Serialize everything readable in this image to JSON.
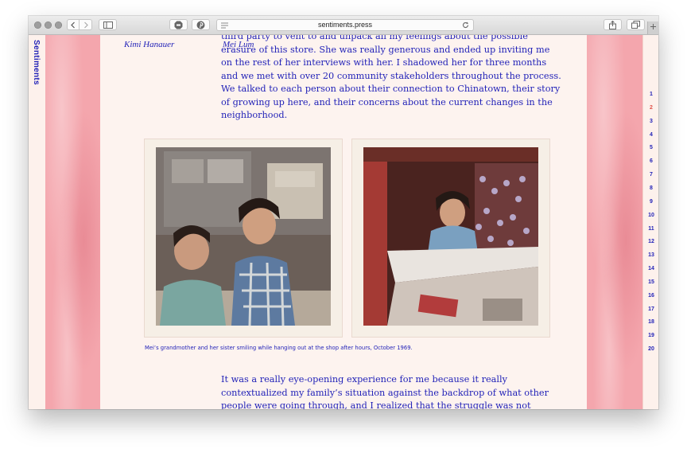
{
  "browser": {
    "url": "sentiments.press",
    "colors": {
      "toolbar": "#dcdcdc",
      "traffic_light": "#9e9e9e"
    }
  },
  "site": {
    "brand": "Sentiments",
    "accent_color": "#2323b8",
    "background_color": "#fdf3ef",
    "side_photo_tint": "#f4a6ad"
  },
  "article": {
    "author": "Kimi Hanauer",
    "subject": "Mei Lum",
    "paragraph_1": "third party to vent to and unpack all my feelings about the possible erasure of this store. She was really generous and ended up inviting me on the rest of her interviews with her. I shadowed her for three months and we met with over 20 community stakeholders throughout the process. We talked to each person about their connection to Chinatown, their story of growing up here, and their concerns about the current changes in the neighborhood.",
    "caption": "Mei’s grandmother and her sister smiling while hanging out at the shop after hours, October 1969.",
    "paragraph_2": "It was a really eye-opening experience for me because it really contextualized my family’s situation against the backdrop of what other people were going through, and I realized that the struggle was not isolated to my family. I also started to think"
  },
  "pages": [
    "1",
    "2",
    "3",
    "4",
    "5",
    "6",
    "7",
    "8",
    "9",
    "10",
    "11",
    "12",
    "13",
    "14",
    "15",
    "16",
    "17",
    "18",
    "19",
    "20"
  ],
  "current_page": "2"
}
